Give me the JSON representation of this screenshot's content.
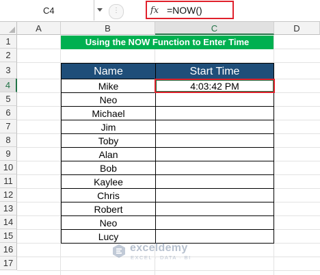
{
  "formula_bar": {
    "name_box": "C4",
    "fx_icon": "fx-icon",
    "formula": "=NOW()"
  },
  "columns": [
    "A",
    "B",
    "C",
    "D"
  ],
  "rows": [
    "1",
    "2",
    "3",
    "4",
    "5",
    "6",
    "7",
    "8",
    "9",
    "10",
    "11",
    "12",
    "13",
    "14",
    "15",
    "16",
    "17"
  ],
  "title": "Using the NOW Function to Enter Time",
  "table": {
    "headers": [
      "Name",
      "Start Time"
    ],
    "rows": [
      {
        "name": "Mike",
        "start_time": "4:03:42 PM"
      },
      {
        "name": "Neo",
        "start_time": ""
      },
      {
        "name": "Michael",
        "start_time": ""
      },
      {
        "name": "Jim",
        "start_time": ""
      },
      {
        "name": "Toby",
        "start_time": ""
      },
      {
        "name": "Alan",
        "start_time": ""
      },
      {
        "name": "Bob",
        "start_time": ""
      },
      {
        "name": "Kaylee",
        "start_time": ""
      },
      {
        "name": "Chris",
        "start_time": ""
      },
      {
        "name": "Robert",
        "start_time": ""
      },
      {
        "name": "Neo",
        "start_time": ""
      },
      {
        "name": "Lucy",
        "start_time": ""
      }
    ]
  },
  "watermark": {
    "name": "exceldemy",
    "tagline": "EXCEL · DATA · BI"
  },
  "colors": {
    "title_bg": "#00b050",
    "header_bg": "#1f4e79",
    "highlight": "#e0202b",
    "selection": "#217346"
  }
}
